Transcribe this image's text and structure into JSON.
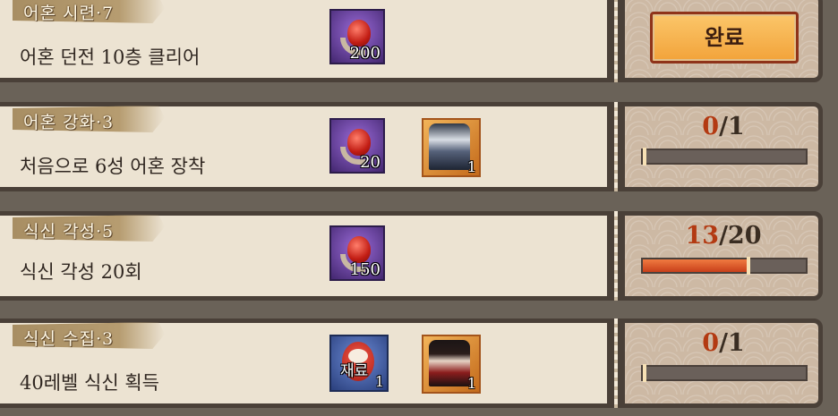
{
  "quests": [
    {
      "title": "어혼 시련·7",
      "desc": "어혼 던전 10층 클리어",
      "rewards": [
        {
          "icon": "red-soul-gem-icon",
          "count": "200"
        }
      ],
      "status": "complete",
      "button_label": "완료"
    },
    {
      "title": "어혼 강화·3",
      "desc": "처음으로 6성 어혼 장착",
      "rewards": [
        {
          "icon": "red-soul-gem-icon",
          "count": "20"
        },
        {
          "icon": "shikigami-portrait-icon",
          "count": "1"
        }
      ],
      "status": "progress",
      "current": "0",
      "total": "/1",
      "fraction": 0
    },
    {
      "title": "식신 각성·5",
      "desc": "식신 각성 20회",
      "rewards": [
        {
          "icon": "red-soul-gem-icon",
          "count": "150"
        }
      ],
      "status": "progress",
      "current": "13",
      "total": "/20",
      "fraction": 0.65
    },
    {
      "title": "식신 수집·3",
      "desc": "40레벨 식신 획득",
      "rewards": [
        {
          "icon": "daruma-material-icon",
          "label": "재료",
          "count": "1"
        },
        {
          "icon": "shikigami-portrait-icon",
          "count": "1"
        }
      ],
      "status": "progress",
      "current": "0",
      "total": "/1",
      "fraction": 0
    }
  ],
  "colors": {
    "accent_red": "#b33a12",
    "button_orange": "#f2a33a",
    "bar_fill": "#e0602c"
  }
}
